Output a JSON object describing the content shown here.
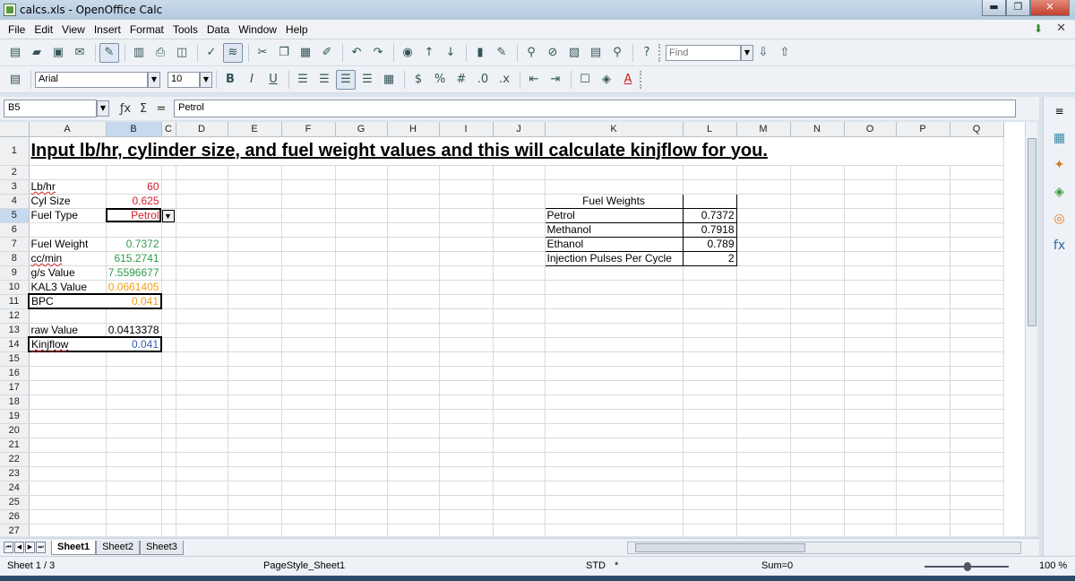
{
  "window": {
    "title": "calcs.xls - OpenOffice Calc",
    "minimize": "▬",
    "maximize": "❐",
    "close": "✕"
  },
  "menu": [
    "File",
    "Edit",
    "View",
    "Insert",
    "Format",
    "Tools",
    "Data",
    "Window",
    "Help"
  ],
  "toolbar": {
    "find_placeholder": "Find"
  },
  "format_bar": {
    "font": "Arial",
    "size": "10"
  },
  "formula_bar": {
    "name_box": "B5",
    "content": "Petrol"
  },
  "columns": [
    "A",
    "B",
    "C",
    "D",
    "E",
    "F",
    "G",
    "H",
    "I",
    "J",
    "K",
    "L",
    "M",
    "N",
    "O",
    "P",
    "Q"
  ],
  "rows": [
    "1",
    "2",
    "3",
    "4",
    "5",
    "6",
    "7",
    "8",
    "9",
    "10",
    "11",
    "12",
    "13",
    "14",
    "15",
    "16",
    "17",
    "18",
    "19",
    "20",
    "21",
    "22",
    "23",
    "24",
    "25",
    "26",
    "27"
  ],
  "cells": {
    "A1": "Input lb/hr, cylinder size, and fuel weight values and this will calculate kinjflow for you.",
    "A3": "Lb/hr",
    "B3": "60",
    "A4": "Cyl Size",
    "B4": "0.625",
    "A5": "Fuel Type",
    "B5": "Petrol",
    "A7": "Fuel Weight",
    "B7": "0.7372",
    "A8": "cc/min",
    "B8": "615.2741",
    "A9": "g/s Value",
    "B9": "7.5596677",
    "A10": "KAL3 Value",
    "B10": "0.0661405",
    "A11": "BPC",
    "B11": "0.041",
    "A13": "raw Value",
    "B13": "0.0413378",
    "A14": "Kinjflow",
    "B14": "0.041"
  },
  "fuel_table": {
    "title": "Fuel Weights",
    "rows": [
      {
        "name": "Petrol",
        "value": "0.7372"
      },
      {
        "name": "Methanol",
        "value": "0.7918"
      },
      {
        "name": "Ethanol",
        "value": "0.789"
      },
      {
        "name": "Injection Pulses Per Cycle",
        "value": "2"
      }
    ]
  },
  "sheet_tabs": [
    "Sheet1",
    "Sheet2",
    "Sheet3"
  ],
  "status": {
    "sheet": "Sheet 1 / 3",
    "page_style": "PageStyle_Sheet1",
    "mode": "STD",
    "modified": "*",
    "sum": "Sum=0",
    "zoom": "100 %"
  },
  "colors": {
    "red": "#d0202a",
    "green": "#2e9a4a",
    "orange": "#f0a020",
    "blue": "#3060c0",
    "selected_header": "#c6d9ee"
  }
}
